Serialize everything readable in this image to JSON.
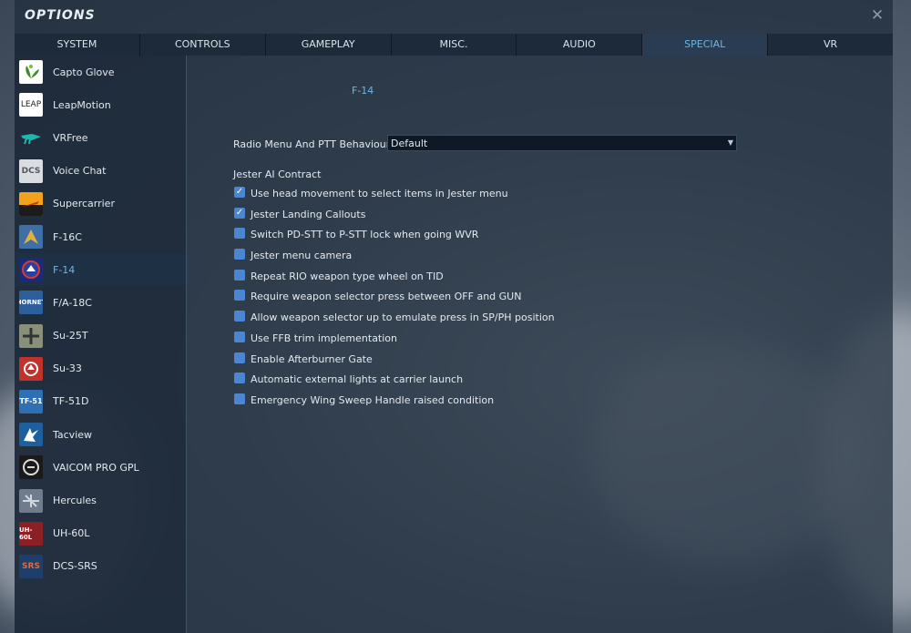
{
  "window": {
    "title": "OPTIONS",
    "close_glyph": "✕"
  },
  "tabs": [
    {
      "label": "SYSTEM"
    },
    {
      "label": "CONTROLS"
    },
    {
      "label": "GAMEPLAY"
    },
    {
      "label": "MISC."
    },
    {
      "label": "AUDIO"
    },
    {
      "label": "SPECIAL",
      "active": true
    },
    {
      "label": "VR"
    }
  ],
  "sidebar": {
    "items": [
      {
        "label": "Capto Glove",
        "icon": "capto-glove-icon"
      },
      {
        "label": "LeapMotion",
        "icon": "leapmotion-icon"
      },
      {
        "label": "VRFree",
        "icon": "vrfree-icon"
      },
      {
        "label": "Voice Chat",
        "icon": "voice-chat-icon"
      },
      {
        "label": "Supercarrier",
        "icon": "supercarrier-icon"
      },
      {
        "label": "F-16C",
        "icon": "f16c-icon"
      },
      {
        "label": "F-14",
        "icon": "f14-icon",
        "active": true
      },
      {
        "label": "F/A-18C",
        "icon": "fa18c-icon"
      },
      {
        "label": "Su-25T",
        "icon": "su25t-icon"
      },
      {
        "label": "Su-33",
        "icon": "su33-icon"
      },
      {
        "label": "TF-51D",
        "icon": "tf51d-icon"
      },
      {
        "label": "Tacview",
        "icon": "tacview-icon"
      },
      {
        "label": "VAICOM PRO GPL",
        "icon": "vaicom-icon"
      },
      {
        "label": "Hercules",
        "icon": "hercules-icon"
      },
      {
        "label": "UH-60L",
        "icon": "uh60l-icon"
      },
      {
        "label": "DCS-SRS",
        "icon": "dcs-srs-icon"
      }
    ]
  },
  "content": {
    "section_title": "F-14",
    "radio_menu_label": "Radio Menu And PTT Behaviour",
    "radio_menu_value": "Default",
    "jester_group_label": "Jester AI Contract",
    "options": [
      {
        "label": "Use head movement to select items in Jester menu",
        "checked": true
      },
      {
        "label": "Jester Landing Callouts",
        "checked": true
      },
      {
        "label": "Switch PD-STT to P-STT lock when going WVR",
        "checked": false
      },
      {
        "label": "Jester menu camera",
        "checked": false
      },
      {
        "label": "Repeat RIO weapon type wheel on TID",
        "checked": false
      },
      {
        "label": "Require weapon selector press between OFF and GUN",
        "checked": false
      },
      {
        "label": "Allow weapon selector up to emulate press in SP/PH position",
        "checked": false
      },
      {
        "label": "Use FFB trim implementation",
        "checked": false
      },
      {
        "label": "Enable Afterburner Gate",
        "checked": false
      },
      {
        "label": "Automatic external lights at carrier launch",
        "checked": false
      },
      {
        "label": "Emergency Wing Sweep Handle raised condition",
        "checked": false
      }
    ]
  },
  "colors": {
    "accent": "#68b6e6",
    "checkbox": "#4a86d1",
    "panel": "#1f2c3c"
  }
}
